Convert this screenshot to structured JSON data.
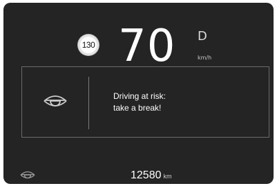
{
  "speed_limit": "130",
  "speed": "70",
  "gear": "D",
  "speed_unit": "km/h",
  "alert": {
    "icon": "drowsy-eye-icon",
    "line1": "Driving at risk:",
    "line2": "take a break!"
  },
  "odometer": {
    "icon": "drowsy-eye-icon",
    "value": "12580",
    "unit": "km"
  },
  "colors": {
    "background": "#242424",
    "text": "#ffffff",
    "panel_border": "#6b6b6b"
  }
}
